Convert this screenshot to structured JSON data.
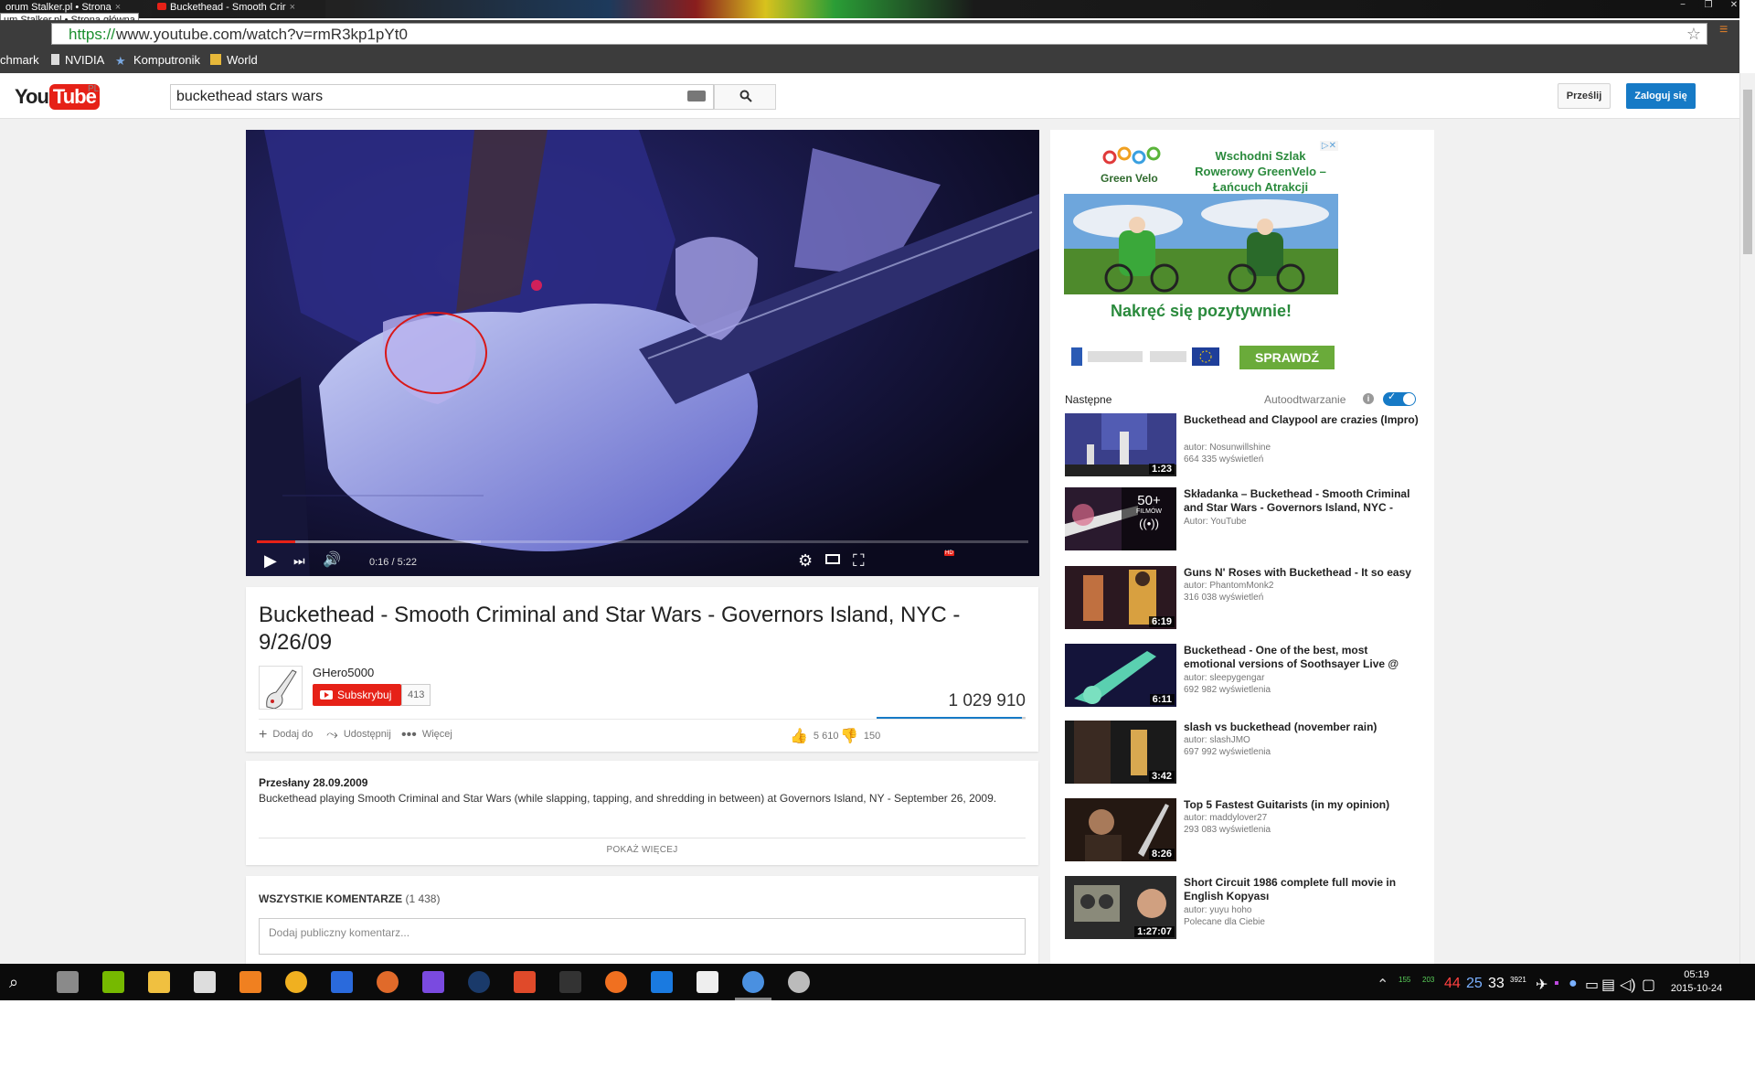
{
  "browser": {
    "tabs": [
      {
        "label": "orum Stalker.pl • Strona",
        "close": "×"
      },
      {
        "label": "Buckethead - Smooth Crir",
        "close": "×"
      }
    ],
    "tab_tooltip": "um Stalker.pl • Strona główna",
    "url_scheme": "https://",
    "url_rest": "www.youtube.com/watch?v=rmR3kp1pYt0",
    "window_controls": [
      "−",
      "❐",
      "✕"
    ],
    "bookmarks": [
      "chmark",
      "NVIDIA",
      "Komputronik",
      "World"
    ]
  },
  "yt": {
    "logo_you": "You",
    "logo_tube": "Tube",
    "locale": "PL",
    "search_value": "buckethead stars wars",
    "upload_label": "Prześlij",
    "signin_label": "Zaloguj się"
  },
  "player": {
    "time": "0:16 / 5:22",
    "progress_played": 0.05,
    "progress_buffered": 0.29,
    "hd": "HD"
  },
  "video": {
    "title": "Buckethead - Smooth Criminal and Star Wars - Governors Island, NYC - 9/26/09",
    "channel": "GHero5000",
    "subscribe_label": "Subskrybuj",
    "subscribers": "413",
    "views": "1 029 910",
    "like_ratio": 0.974,
    "add_to": "Dodaj do",
    "share": "Udostępnij",
    "more": "Więcej",
    "likes": "5 610",
    "dislikes": "150",
    "published": "Przesłany 28.09.2009",
    "description": "Buckethead playing Smooth Criminal and Star Wars (while slapping, tapping, and shredding in between) at Governors Island, NY - September 26, 2009.",
    "show_more": "POKAŻ WIĘCEJ",
    "comments_heading": "WSZYSTKIE KOMENTARZE",
    "comments_count": "(1 438)",
    "comment_placeholder": "Dodaj publiczny komentarz..."
  },
  "ad": {
    "logo": "Green Velo",
    "headline": "Wschodni Szlak Rowerowy GreenVelo – Łańcuch Atrakcji",
    "tagline": "Nakręć się pozytywnie!",
    "cta": "SPRAWDŹ"
  },
  "sidebar": {
    "next_label": "Następne",
    "autoplay_label": "Autoodtwarzanie",
    "autoplay_on": true,
    "items": [
      {
        "title": "Buckethead and Claypool are crazies (Impro)",
        "author": "autor: Nosunwillshine",
        "views": "664 335 wyświetleń",
        "duration": "1:23"
      },
      {
        "title": "Składanka – Buckethead - Smooth Criminal and Star Wars - Governors Island, NYC -",
        "author": "Autor: YouTube",
        "views": "",
        "duration": "",
        "playlist_count": "50+",
        "playlist_label": "FILMÓW"
      },
      {
        "title": "Guns N' Roses with Buckethead - It so easy",
        "author": "autor: PhantomMonk2",
        "views": "316 038 wyświetleń",
        "duration": "6:19"
      },
      {
        "title": "Buckethead - One of the best, most emotional versions of Soothsayer Live @",
        "author": "autor: sleepygengar",
        "views": "692 982 wyświetlenia",
        "duration": "6:11"
      },
      {
        "title": "slash vs buckethead (november rain)",
        "author": "autor: slashJMO",
        "views": "697 992 wyświetlenia",
        "duration": "3:42"
      },
      {
        "title": "Top 5 Fastest Guitarists (in my opinion)",
        "author": "autor: maddylover27",
        "views": "293 083 wyświetlenia",
        "duration": "8:26"
      },
      {
        "title": "Short Circuit 1986 complete full movie in English Kopyası",
        "author": "autor: yuyu hoho",
        "views": "Polecane dla Ciebie",
        "duration": "1:27:07"
      }
    ]
  },
  "taskbar": {
    "tray": [
      "155",
      "203",
      "44",
      "25",
      "33",
      "3921"
    ],
    "time": "05:19",
    "date": "2015-10-24"
  },
  "colors": {
    "yt_red": "#e62117",
    "yt_blue": "#167ac6",
    "ad_green": "#2a8a3c"
  }
}
